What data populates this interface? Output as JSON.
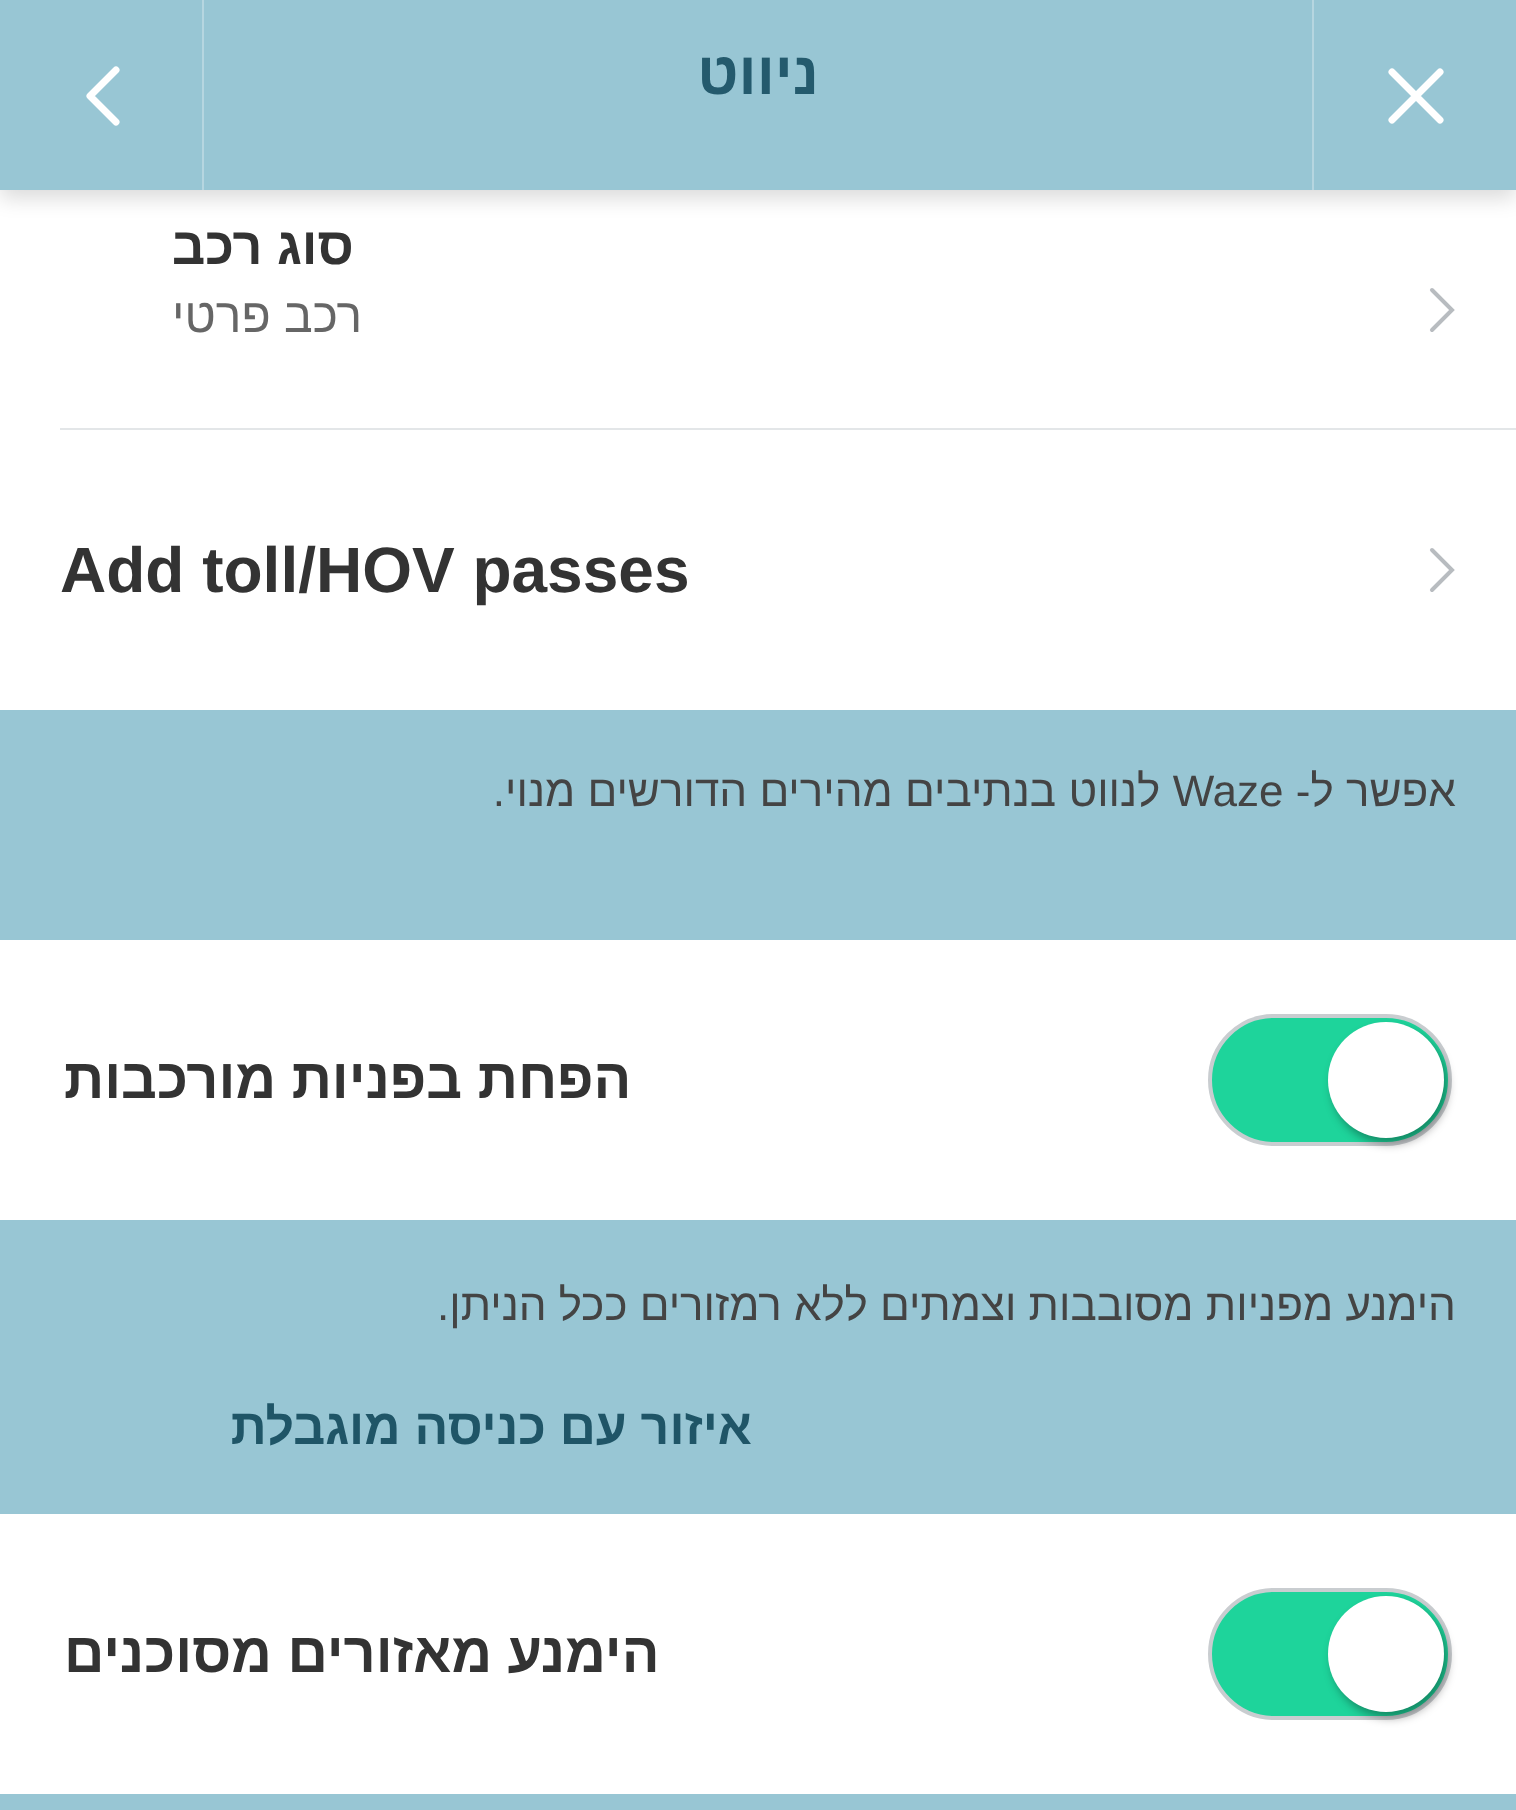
{
  "header": {
    "title": "ניווט"
  },
  "blocks": [
    {
      "kind": "links",
      "rows": [
        {
          "label": "סוג רכב",
          "value": "רכב פרטי"
        },
        {
          "label": "Add toll/HOV passes"
        }
      ]
    },
    {
      "kind": "note",
      "text": "אפשר ל- Waze לנווט בנתיבים מהירים הדורשים מנוי."
    },
    {
      "kind": "toggle",
      "label": "הפחת בפניות מורכבות",
      "on": true
    },
    {
      "kind": "note",
      "text": "הימנע מפניות מסובבות וצמתים ללא רמזורים ככל הניתן.",
      "heading": "איזור עם כניסה מוגבלת"
    },
    {
      "kind": "toggle",
      "label": "הימנע מאזורים מסוכנים",
      "on": true
    }
  ]
}
